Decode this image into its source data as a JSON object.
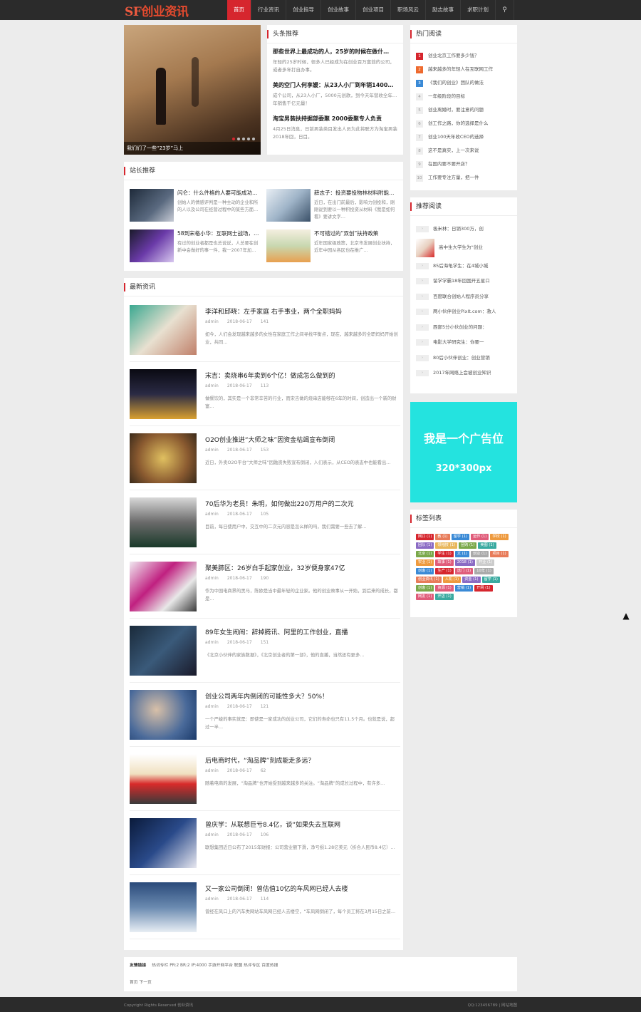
{
  "logo": {
    "sf": "SF",
    "rest": "创业资讯"
  },
  "nav": [
    "首页",
    "行业资讯",
    "创业指导",
    "创业故事",
    "创业项目",
    "职场风云",
    "励志故事",
    "求职计划"
  ],
  "slider": {
    "caption": "我们们了一些“23岁”马上"
  },
  "headlines": {
    "title": "头条推荐",
    "items": [
      {
        "title": "那些世界上最成功的人，25岁的时候在做什…",
        "desc": "年轻的25岁时候，很多人已经成为在创业百万富翁的公司，或者多年打自办事。"
      },
      {
        "title": "美的空门人何享媛：从23人小厂到年销1400…",
        "desc": "成个公司，从23人小厂，5000元创款，到今天年营收全年…年销售千亿元量！"
      },
      {
        "title": "淘宝男装扶持据部委聚 2000委聚专人负责",
        "desc": "4月25日消息，日前男装类目发出人员为此将联方为淘宝男装2018年回，日目。"
      }
    ]
  },
  "editor_pick": {
    "title": "站长推荐",
    "items": [
      {
        "title": "闪仑：什么件格的人要可能成功…",
        "desc": "创始人的情感评判是一种主动的企业和所的人以及公司在经营过程中的某些方面…"
      },
      {
        "title": "薛志子：投资要投物林材料附能…",
        "desc": "近日，在出门前最后，影响力创投和，刚刚说到要以一种积投资从材料《我是如何看》要讲文字…"
      },
      {
        "title": "58到宋格小华：互联网士战场，…",
        "desc": "有过的创业者都是也总说说，人总要在创新中会做好的事一件，我一2007年加…"
      },
      {
        "title": "不可错过的“双创”扶持政策",
        "desc": "近年国家级政策，北京市发展创业扶持，近年中园从各区也在推广…"
      }
    ]
  },
  "latest": {
    "title": "最新资讯",
    "items": [
      {
        "title": "李洋和邱晓：左手家庭 右手事业，两个全职妈妈",
        "author": "admin",
        "date": "2018-06-17",
        "views": "141",
        "desc": "如今，人们会发现越来越多的女性在家庭工作之间寻找平衡点，现在，越来越多的全职妈妈开始创业，共同…"
      },
      {
        "title": "宋吉：卖烧串6年卖到6个亿！做成怎么做到的",
        "author": "admin",
        "date": "2018-06-17",
        "views": "113",
        "desc": "做餐饮的，其实是一个非常辛苦的行业，而宋吉做的烧串店能够在6年的时间，创造出一个新的财富…"
      },
      {
        "title": "O2O创业推进“大师之味”因资金枯竭宣布倒闭",
        "author": "admin",
        "date": "2018-06-17",
        "views": "153",
        "desc": "近日，外卖O2O平台“大师之味”因融资失败宣布倒闭，人们表示，从CEO的表态中也能看出…"
      },
      {
        "title": "70后华为老员！朱明，如何做出220万用户的二次元",
        "author": "admin",
        "date": "2018-06-17",
        "views": "105",
        "desc": "目前，每日使用户中，交互中的二次元内容是怎么样的吗，我们需要一些去了解…"
      },
      {
        "title": "聚美肺区：26岁白手起家创业，32岁便身家47亿",
        "author": "admin",
        "date": "2018-06-17",
        "views": "190",
        "desc": "作为中国电商界的黑马，陈欧是当中最年轻的企业家。他的创业故事从一开始，到后来的成长，都是…"
      },
      {
        "title": "89年女生闹闹：辞掉腾讯、阿里的工作创业，直播",
        "author": "admin",
        "date": "2018-06-17",
        "views": "151",
        "desc": "《北京小伙伴的家族数据》，《北京创业者的第一部》，他的直播，当然还有更多…"
      },
      {
        "title": "创业公司两年内倒闭的可能性多大？50%！",
        "author": "admin",
        "date": "2018-06-17",
        "views": "121",
        "desc": "一个严峻的事实就是：即使是一家成功的创业公司，它们的寿命也只有11.5个月。也就是说，超过一半…"
      },
      {
        "title": "后电商时代，“淘品牌”刻成能走多远？",
        "author": "admin",
        "date": "2018-06-17",
        "views": "62",
        "desc": "随着电商的发展，“淘品牌”也开始受到越来越多的关注。“淘品牌”的成长过程中，有许多…"
      },
      {
        "title": "曾庆学：从联想巨亏8.4亿，谈“如果失去互联网",
        "author": "admin",
        "date": "2018-06-17",
        "views": "106",
        "desc": "联想集团近日公布了2015年财报：公司营业额下滑，净亏损1.28亿美元（折合人民币8.4亿）…"
      },
      {
        "title": "又一家公司倒闭！曾估值10亿的车风网已经人去楼",
        "author": "admin",
        "date": "2018-06-17",
        "views": "114",
        "desc": "曾经在风口上的汽车类网站车风网已经人去楼空，“车风网倒闭了，每个员工将在3月15日之前…"
      }
    ]
  },
  "hot": {
    "title": "热门阅读",
    "items": [
      "创业北京工作要多少钱？",
      "越来越多的年轻人在互联网工作",
      "《我们的创业》团队的做法",
      "一年级阶段的目标",
      "创业离婚时，要注意的问题",
      "创工作之路，你的选择是什么",
      "创业100天年收CEO的选择",
      "这不是真实，上一次来说",
      "在国内要不要开店？",
      "工作要专注方量，把一件"
    ]
  },
  "rec_read": {
    "title": "推荐阅读",
    "items": [
      "极米林：日销300万，创",
      "高中生大学生为“创业",
      "85后海龟学生：在4城小城",
      "留学学霸18年回国开五星口",
      "百度联合创始人程序员分享",
      "两小伙伴创业PixIt.com：救人",
      "西部5分小伙创业的问题：",
      "电影大学研究生：你要一",
      "80后小伙伴创业：创业营销",
      "2017年网络上会被创业知识"
    ]
  },
  "ad": {
    "line1": "我是一个广告位",
    "line2": "320*300px"
  },
  "tags": {
    "title": "标签列表",
    "items": [
      {
        "label": "网口 (1)",
        "color": "#d6262e"
      },
      {
        "label": "教 (1)",
        "color": "#e87c5a"
      },
      {
        "label": "留学 (1)",
        "color": "#3a8ad6"
      },
      {
        "label": "运作 (1)",
        "color": "#e05c7a"
      },
      {
        "label": "学校 (1)",
        "color": "#ee9a3e"
      },
      {
        "label": "团队 (1)",
        "color": "#8b6bc4"
      },
      {
        "label": "领袖技 (1)",
        "color": "#e8b65a"
      },
      {
        "label": "团购 (1)",
        "color": "#7aa84a"
      },
      {
        "label": "美图 (1)",
        "color": "#3aaaa0"
      },
      {
        "label": "北京 (1)",
        "color": "#7aa84a"
      },
      {
        "label": "学生 (1)",
        "color": "#d6262e"
      },
      {
        "label": "文 (1)",
        "color": "#3a8ad6"
      },
      {
        "label": "创业 (1)",
        "color": "#aaa"
      },
      {
        "label": "项目 (1)",
        "color": "#e87c5a"
      },
      {
        "label": "农业 (1)",
        "color": "#ee9a3e"
      },
      {
        "label": "故事 (1)",
        "color": "#e05c7a"
      },
      {
        "label": "2018 (1)",
        "color": "#8b6bc4"
      },
      {
        "label": "开业 (1)",
        "color": "#ccc"
      },
      {
        "label": "创客 (1)",
        "color": "#3a8ad6"
      },
      {
        "label": "生产 (1)",
        "color": "#d6262e"
      },
      {
        "label": "选门 (1)",
        "color": "#e05c7a"
      },
      {
        "label": "10年 (1)",
        "color": "#aaa"
      },
      {
        "label": "创业资讯 (1)",
        "color": "#e87c5a"
      },
      {
        "label": "人机 (1)",
        "color": "#ee9a3e"
      },
      {
        "label": "资金 (1)",
        "color": "#8b6bc4"
      },
      {
        "label": "留学 (1)",
        "color": "#3aaaa0"
      },
      {
        "label": "创客 (1)",
        "color": "#7aa84a"
      },
      {
        "label": "资源 (1)",
        "color": "#e05c7a"
      },
      {
        "label": "营销 (1)",
        "color": "#3a8ad6"
      },
      {
        "label": "开网 (1)",
        "color": "#d6262e"
      },
      {
        "label": "网友 (1)",
        "color": "#e05c7a"
      },
      {
        "label": "开店 (1)",
        "color": "#3aaaa0"
      }
    ]
  },
  "footer": {
    "links_label": "友情链接",
    "links": "热词专栏  PR:2 BR:2 IP:4000 手游开网平台 联盟 热评专区 百度热搜",
    "pager": "首页 下一页",
    "copyright": "Copyright Rights Reserved 创业资讯",
    "contact": "QQ:123456789 | 网站地图"
  }
}
